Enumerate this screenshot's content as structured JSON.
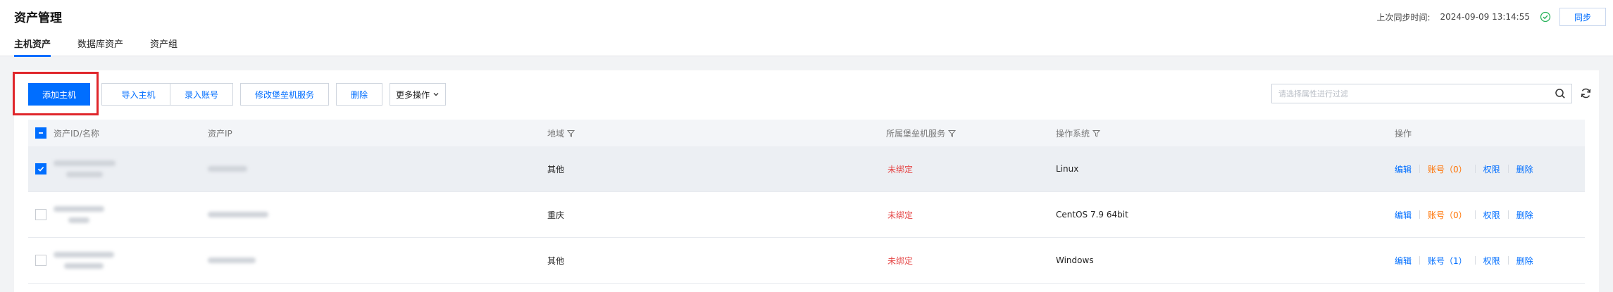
{
  "page": {
    "title": "资产管理",
    "tabs": [
      "主机资产",
      "数据库资产",
      "资产组"
    ],
    "active_tab": "主机资产"
  },
  "sync": {
    "label": "上次同步时间:",
    "time": "2024-09-09 13:14:55",
    "button": "同步"
  },
  "toolbar": {
    "add_host": "添加主机",
    "import_host": "导入主机",
    "enter_account": "录入账号",
    "modify_bastion": "修改堡垒机服务",
    "delete": "删除",
    "more": "更多操作",
    "search_placeholder": "请选择属性进行过滤"
  },
  "table": {
    "columns": [
      "资产ID/名称",
      "资产IP",
      "地域",
      "所属堡垒机服务",
      "操作系统",
      "操作"
    ],
    "rows": [
      {
        "region": "其他",
        "bastion": "未绑定",
        "os": "Linux",
        "edit": "编辑",
        "account": "账号（0）",
        "perm": "权限",
        "del": "删除",
        "checked": true
      },
      {
        "region": "重庆",
        "bastion": "未绑定",
        "os": "CentOS 7.9 64bit",
        "edit": "编辑",
        "account": "账号（0）",
        "perm": "权限",
        "del": "删除",
        "checked": false
      },
      {
        "region": "其他",
        "bastion": "未绑定",
        "os": "Windows",
        "edit": "编辑",
        "account": "账号（1）",
        "perm": "权限",
        "del": "删除",
        "checked": false
      }
    ]
  },
  "colors": {
    "accent": "#006eff",
    "unbound": "#e54545",
    "account_zero": "#ff7200",
    "highlight": "#e0262b"
  }
}
